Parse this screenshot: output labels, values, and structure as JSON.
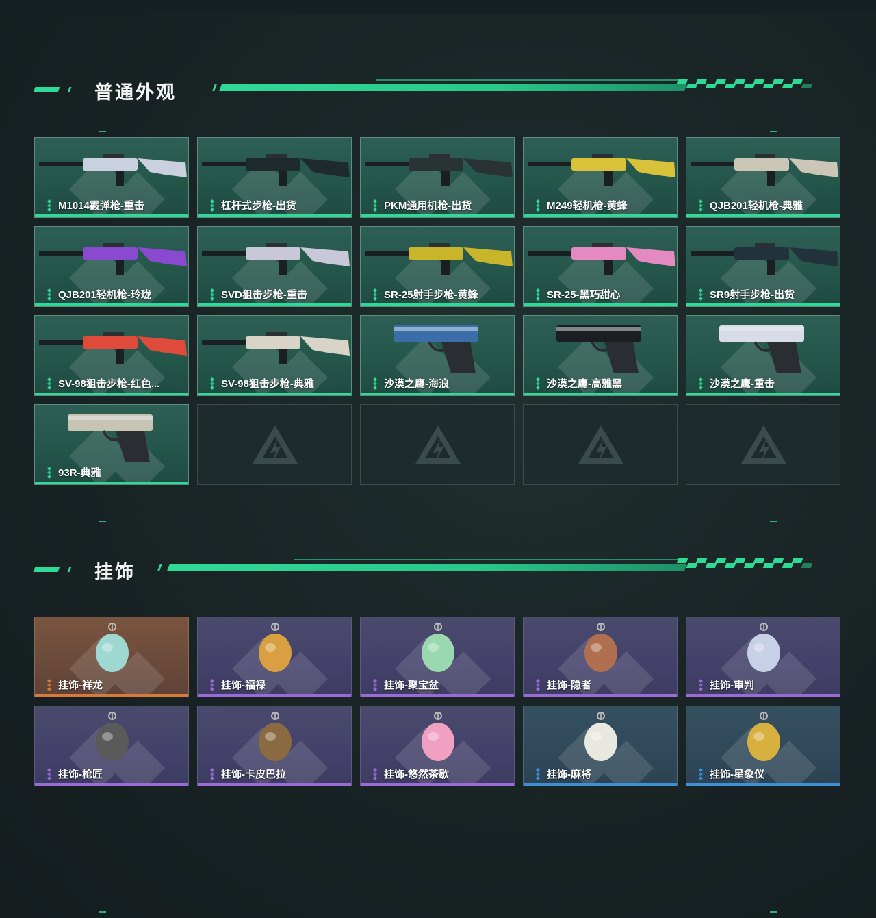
{
  "sections": [
    {
      "title": "普通外观",
      "items": [
        {
          "label": "M1014霰弹枪-重击",
          "rarity": "green"
        },
        {
          "label": "杠杆式步枪-出货",
          "rarity": "green"
        },
        {
          "label": "PKM通用机枪-出货",
          "rarity": "green"
        },
        {
          "label": "M249轻机枪-黄蜂",
          "rarity": "green"
        },
        {
          "label": "QJB201轻机枪-典雅",
          "rarity": "green"
        },
        {
          "label": "QJB201轻机枪-玲珑",
          "rarity": "green"
        },
        {
          "label": "SVD狙击步枪-重击",
          "rarity": "green"
        },
        {
          "label": "SR-25射手步枪-黄蜂",
          "rarity": "green"
        },
        {
          "label": "SR-25-黑巧甜心",
          "rarity": "green"
        },
        {
          "label": "SR9射手步枪-出货",
          "rarity": "green"
        },
        {
          "label": "SV-98狙击步枪-红色...",
          "rarity": "green"
        },
        {
          "label": "SV-98狙击步枪-典雅",
          "rarity": "green"
        },
        {
          "label": "沙漠之鹰-海浪",
          "rarity": "green"
        },
        {
          "label": "沙漠之鹰-高雅黑",
          "rarity": "green"
        },
        {
          "label": "沙漠之鹰-重击",
          "rarity": "green"
        },
        {
          "label": "93R-典雅",
          "rarity": "green"
        }
      ]
    },
    {
      "title": "挂饰",
      "items": [
        {
          "label": "挂饰-祥龙",
          "rarity": "orange"
        },
        {
          "label": "挂饰-福禄",
          "rarity": "purple"
        },
        {
          "label": "挂饰-聚宝盆",
          "rarity": "purple"
        },
        {
          "label": "挂饰-隐者",
          "rarity": "purple"
        },
        {
          "label": "挂饰-审判",
          "rarity": "purple"
        },
        {
          "label": "挂饰-枪匠",
          "rarity": "purple"
        },
        {
          "label": "挂饰-卡皮巴拉",
          "rarity": "purple"
        },
        {
          "label": "挂饰-悠然茶歇",
          "rarity": "purple"
        },
        {
          "label": "挂饰-麻将",
          "rarity": "blue"
        },
        {
          "label": "挂饰-星象仪",
          "rarity": "blue"
        }
      ]
    }
  ],
  "colors": {
    "accent": "#2fd996",
    "green": "#2fd996",
    "orange": "#d87a3a",
    "purple": "#9b6ad8",
    "blue": "#3d8fd8"
  },
  "icons": {
    "rarity": "diamond-cluster-icon",
    "watermark": "delta-logo-icon"
  }
}
